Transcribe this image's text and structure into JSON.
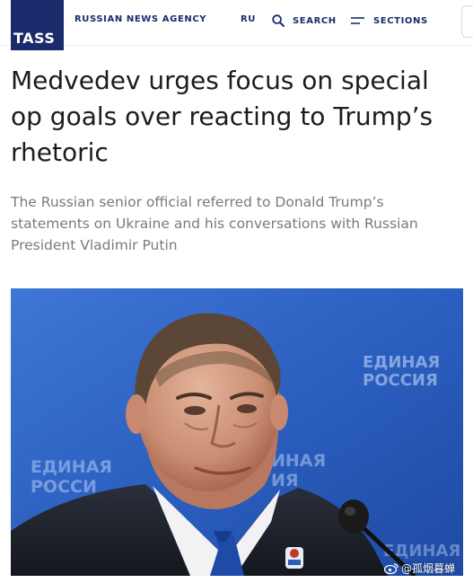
{
  "header": {
    "logo_text": "TASS",
    "agency_name": "RUSSIAN NEWS AGENCY",
    "language": "RU",
    "search_label": "SEARCH",
    "sections_label": "SECTIONS",
    "brand_color": "#1a2b6b"
  },
  "article": {
    "headline": "Medvedev urges focus on special op goals over reacting to Trump’s rhetoric",
    "subtitle": "The Russian senior official referred to Donald Trump’s statements on Ukraine and his conversations with Russian President Vladimir Putin",
    "photo": {
      "backdrop_text": "ЕДИНАЯ РОССИЯ",
      "backdrop_color": "#2a5cb8"
    }
  },
  "watermark": {
    "text": "@孤烟暮蝉",
    "icon": "weibo-icon"
  }
}
